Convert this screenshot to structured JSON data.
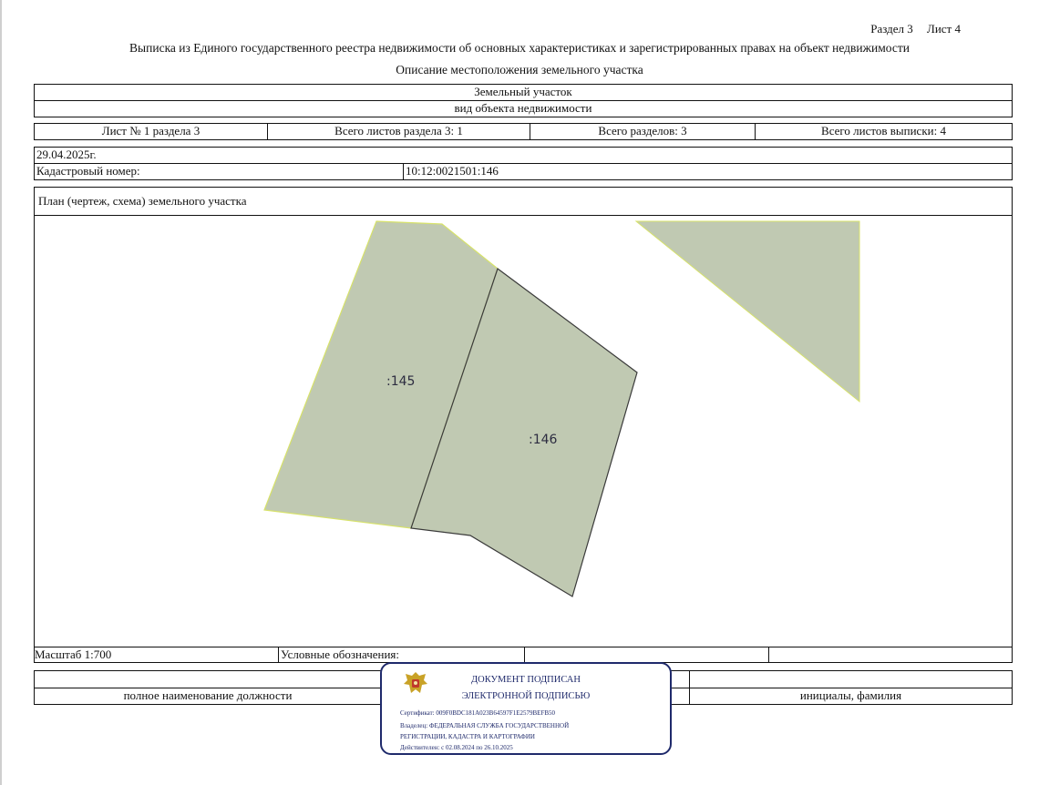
{
  "header": {
    "section": "Раздел 3",
    "sheet": "Лист 4",
    "title": "Выписка из Единого государственного реестра недвижимости об основных характеристиках и зарегистрированных правах на объект недвижимости",
    "subtitle": "Описание местоположения земельного участка"
  },
  "object": {
    "type": "Земельный участок",
    "type_caption": "вид объекта недвижимости"
  },
  "sheets": {
    "sheet_of_section": "Лист № 1 раздела 3",
    "total_section_sheets": "Всего листов раздела 3: 1",
    "total_sections": "Всего разделов: 3",
    "total_extract_sheets": "Всего листов выписки: 4"
  },
  "info": {
    "date": "29.04.2025г.",
    "cadastral_label": "Кадастровый номер:",
    "cadastral_number": "10:12:0021501:146"
  },
  "plan": {
    "title": "План (чертеж, схема) земельного участка",
    "parcels": [
      {
        "label": ":145",
        "color": "#c0c9b2"
      },
      {
        "label": ":146",
        "color": "#c0c9b2"
      }
    ],
    "scale": "Масштаб 1:700",
    "legend_label": "Условные обозначения:"
  },
  "signature": {
    "position_caption": "полное наименование должности",
    "name_caption": "инициалы, фамилия"
  },
  "stamp": {
    "line1": "ДОКУМЕНТ ПОДПИСАН",
    "line2": "ЭЛЕКТРОННОЙ ПОДПИСЬЮ",
    "certificate": "Сертификат: 009F0BDC181A023B64597F1E2579BEFB50",
    "owner1": "Владелец: ФЕДЕРАЛЬНАЯ СЛУЖБА ГОСУДАРСТВЕННОЙ",
    "owner2": "РЕГИСТРАЦИИ, КАДАСТРА И КАРТОГРАФИИ",
    "validity": "Действителен: с 02.08.2024 по 26.10.2025",
    "border_color": "#1f2a6b"
  }
}
